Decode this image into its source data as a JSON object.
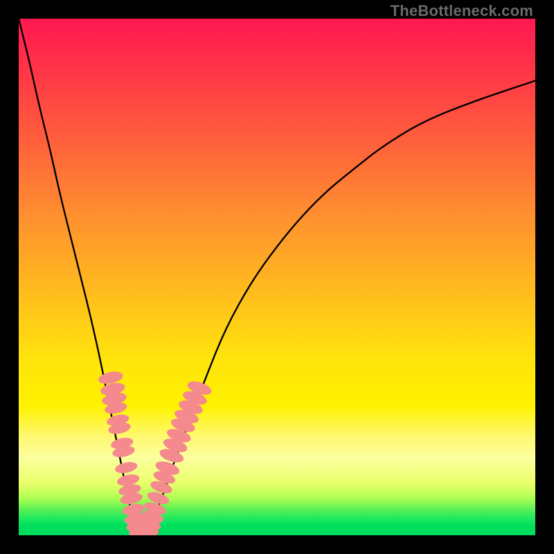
{
  "watermark": {
    "text": "TheBottleneck.com"
  },
  "colors": {
    "frame": "#000000",
    "curve_stroke": "#000000",
    "marker_fill": "#f48a8e",
    "gradient_top": "#ff1852",
    "gradient_bottom": "#00da5e"
  },
  "chart_data": {
    "type": "line",
    "title": "",
    "xlabel": "",
    "ylabel": "",
    "xlim": [
      0,
      100
    ],
    "ylim": [
      0,
      100
    ],
    "series": [
      {
        "name": "bottleneck-curve",
        "x": [
          0,
          2,
          4,
          6,
          8,
          10,
          12,
          14,
          16,
          18,
          19,
          20,
          21,
          22,
          23,
          24,
          25,
          26,
          28,
          30,
          33,
          36,
          40,
          45,
          50,
          55,
          60,
          65,
          70,
          78,
          88,
          100
        ],
        "y": [
          100,
          92,
          83,
          75,
          66,
          58,
          50,
          42,
          33,
          23,
          18,
          13,
          8,
          4,
          1,
          0,
          1,
          3,
          8,
          14,
          22,
          30,
          40,
          49,
          56,
          62,
          67,
          71,
          75,
          80,
          84,
          88
        ]
      }
    ],
    "markers": {
      "name": "highlight-dots",
      "points": [
        {
          "x": 17.8,
          "y": 30.5,
          "r": 1.1
        },
        {
          "x": 18.2,
          "y": 28.3,
          "r": 1.1
        },
        {
          "x": 18.5,
          "y": 26.4,
          "r": 1.1
        },
        {
          "x": 18.8,
          "y": 24.6,
          "r": 1.0
        },
        {
          "x": 19.2,
          "y": 22.3,
          "r": 1.0
        },
        {
          "x": 19.5,
          "y": 20.7,
          "r": 1.0
        },
        {
          "x": 20.0,
          "y": 17.8,
          "r": 1.0
        },
        {
          "x": 20.3,
          "y": 16.2,
          "r": 1.0
        },
        {
          "x": 20.8,
          "y": 13.1,
          "r": 1.0
        },
        {
          "x": 21.2,
          "y": 10.7,
          "r": 1.0
        },
        {
          "x": 21.5,
          "y": 8.8,
          "r": 1.0
        },
        {
          "x": 21.8,
          "y": 7.1,
          "r": 1.0
        },
        {
          "x": 22.2,
          "y": 5.0,
          "r": 1.0
        },
        {
          "x": 22.6,
          "y": 3.2,
          "r": 1.0
        },
        {
          "x": 23.0,
          "y": 1.8,
          "r": 1.0
        },
        {
          "x": 23.5,
          "y": 0.7,
          "r": 1.0
        },
        {
          "x": 24.0,
          "y": 0.2,
          "r": 1.0
        },
        {
          "x": 24.5,
          "y": 0.4,
          "r": 1.0
        },
        {
          "x": 25.0,
          "y": 1.2,
          "r": 1.0
        },
        {
          "x": 25.4,
          "y": 2.2,
          "r": 1.0
        },
        {
          "x": 25.9,
          "y": 3.6,
          "r": 1.0
        },
        {
          "x": 26.4,
          "y": 5.2,
          "r": 1.0
        },
        {
          "x": 27.0,
          "y": 7.2,
          "r": 1.0
        },
        {
          "x": 27.6,
          "y": 9.3,
          "r": 1.0
        },
        {
          "x": 28.2,
          "y": 11.2,
          "r": 1.0
        },
        {
          "x": 28.8,
          "y": 13.0,
          "r": 1.1
        },
        {
          "x": 29.6,
          "y": 15.4,
          "r": 1.1
        },
        {
          "x": 30.3,
          "y": 17.4,
          "r": 1.1
        },
        {
          "x": 31.0,
          "y": 19.3,
          "r": 1.1
        },
        {
          "x": 31.8,
          "y": 21.3,
          "r": 1.1
        },
        {
          "x": 32.5,
          "y": 23.0,
          "r": 1.1
        },
        {
          "x": 33.3,
          "y": 24.8,
          "r": 1.1
        },
        {
          "x": 34.1,
          "y": 26.6,
          "r": 1.1
        },
        {
          "x": 35.0,
          "y": 28.5,
          "r": 1.1
        }
      ]
    }
  }
}
